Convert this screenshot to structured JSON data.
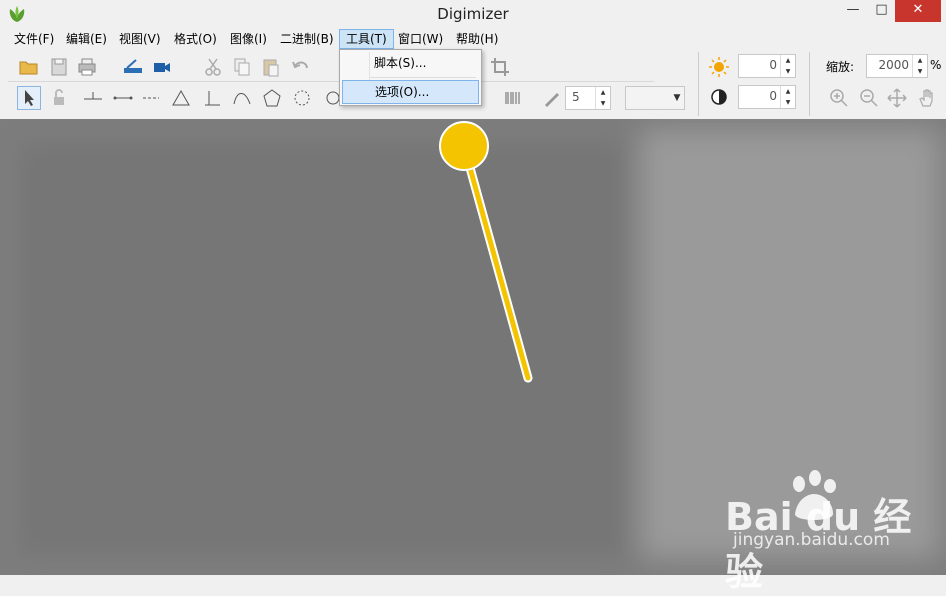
{
  "window": {
    "title": "Digimizer",
    "minimize_icon": "minimize-icon",
    "maximize_icon": "maximize-icon",
    "close_icon": "close-icon",
    "minimize_glyph": "—",
    "maximize_glyph": "□",
    "close_glyph": "✕"
  },
  "menubar": {
    "items": [
      {
        "label": "文件(F)"
      },
      {
        "label": "编辑(E)"
      },
      {
        "label": "视图(V)"
      },
      {
        "label": "格式(O)"
      },
      {
        "label": "图像(I)"
      },
      {
        "label": "二进制(B)"
      },
      {
        "label": "工具(T)",
        "active": true
      },
      {
        "label": "窗口(W)"
      },
      {
        "label": "帮助(H)"
      }
    ]
  },
  "tools_menu": {
    "items": [
      {
        "label": "脚本(S)..."
      },
      {
        "label": "选项(O)...",
        "highlighted": true
      }
    ]
  },
  "toolbar": {
    "line_width_value": "5",
    "brightness_value": "0",
    "contrast_value": "0",
    "zoom_label": "缩放:",
    "zoom_value": "2000",
    "zoom_unit": "%"
  },
  "watermark": {
    "brand": "Bai du 经验",
    "url": "jingyan.baidu.com"
  },
  "colors": {
    "accent_highlight": "#d5e8fb",
    "close_button": "#c7352c",
    "callout": "#f5c400"
  }
}
